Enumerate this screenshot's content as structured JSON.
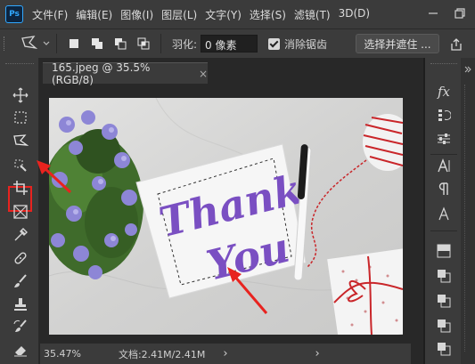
{
  "app": {
    "logo": "Ps",
    "menu": [
      "文件(F)",
      "编辑(E)",
      "图像(I)",
      "图层(L)",
      "文字(Y)",
      "选择(S)",
      "滤镜(T)",
      "3D(D)"
    ]
  },
  "options_bar": {
    "feather_label": "羽化:",
    "feather_value": "0 像素",
    "antialias_label": "消除锯齿",
    "antialias_checked": true,
    "select_mask_label": "选择并遮住 ..."
  },
  "document": {
    "tab_title": "165.jpeg @ 35.5%(RGB/8)",
    "tab_close": "×",
    "card_text_line1": "Thank",
    "card_text_line2": "You"
  },
  "status": {
    "zoom": "35.47%",
    "doc_info": "文档:2.41M/2.41M",
    "arrow": "›"
  },
  "panels": {
    "fx_label": "fx"
  },
  "colors": {
    "accent_red": "#e8231f",
    "ps_blue": "#31a8ff",
    "lettering_purple": "#7a4fc2"
  }
}
